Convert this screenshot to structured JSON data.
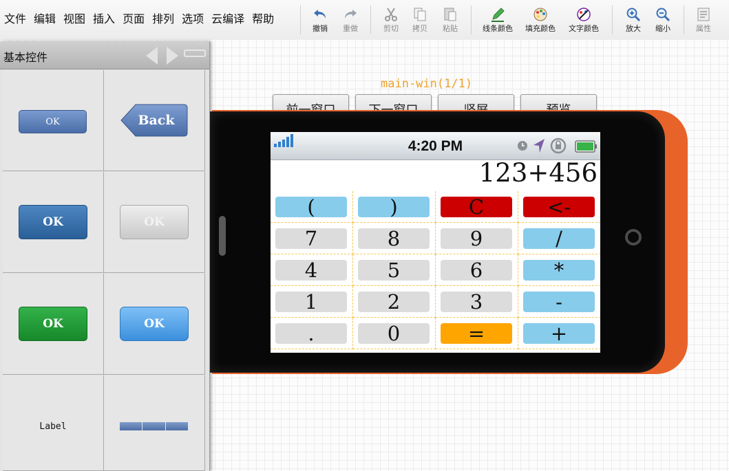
{
  "menu": [
    "文件",
    "编辑",
    "视图",
    "插入",
    "页面",
    "排列",
    "选项",
    "云编译",
    "帮助"
  ],
  "toolbar": {
    "undo": "撤销",
    "redo": "重做",
    "cut": "剪切",
    "copy": "拷贝",
    "paste": "粘贴",
    "line_color": "线条颜色",
    "fill_color": "填充颜色",
    "text_color": "文字颜色",
    "zoom_in": "放大",
    "zoom_out": "缩小",
    "properties": "属性"
  },
  "palette": {
    "title": "基本控件",
    "widgets": {
      "ok_small": "OK",
      "back": "Back",
      "ok_blue": "OK",
      "ok_disabled": "OK",
      "ok_green": "OK",
      "ok_light_blue": "OK",
      "label": "Label"
    }
  },
  "window": {
    "label": "main-win(1/1)",
    "buttons": {
      "prev": "前一窗口",
      "next": "下一窗口",
      "portrait": "竖屏",
      "preview": "预览"
    }
  },
  "phone": {
    "time": "4:20 PM",
    "display": "123+456",
    "keys": [
      [
        "(",
        ")",
        "C",
        "<-"
      ],
      [
        "7",
        "8",
        "9",
        "/"
      ],
      [
        "4",
        "5",
        "6",
        "*"
      ],
      [
        "1",
        "2",
        "3",
        "-"
      ],
      [
        ".",
        "0",
        "=",
        "+"
      ]
    ],
    "key_colors": {
      "paren": "#87cceb",
      "number": "#dcdcdc",
      "clear": "#cc0000",
      "operator": "#87cceb",
      "equals": "#ffa500"
    }
  },
  "colors": {
    "phone_accent": "#e8632a",
    "window_label": "#f0a12a",
    "guide_line": "#f4c64e"
  }
}
